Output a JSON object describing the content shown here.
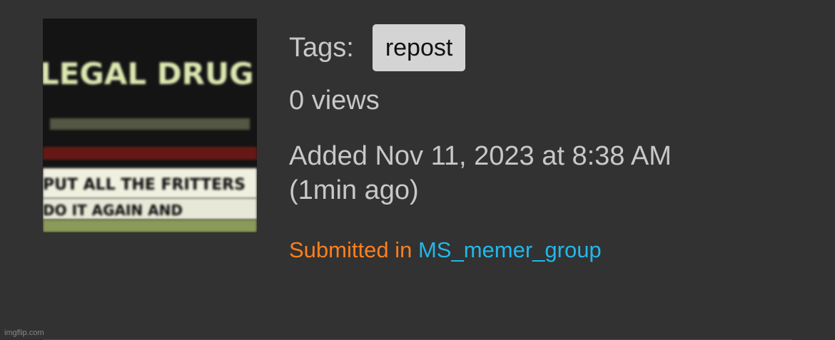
{
  "thumbnail": {
    "line1": "LEGAL DRUG",
    "line2": "PUT ALL THE FRITTERS",
    "line3": "DO IT AGAIN AND"
  },
  "tags": {
    "label": "Tags:",
    "items": [
      "repost"
    ]
  },
  "views": "0 views",
  "added": {
    "date_text": "Added Nov 11, 2023 at 8:38 AM",
    "relative": "(1min ago)"
  },
  "submitted": {
    "label": "Submitted in",
    "group": "MS_memer_group"
  },
  "watermark": "imgflip.com",
  "colors": {
    "background": "#323232",
    "submitted_label": "#ff7f1e",
    "group_link": "#23b7ea",
    "tag_bg": "#d4d4d4"
  }
}
